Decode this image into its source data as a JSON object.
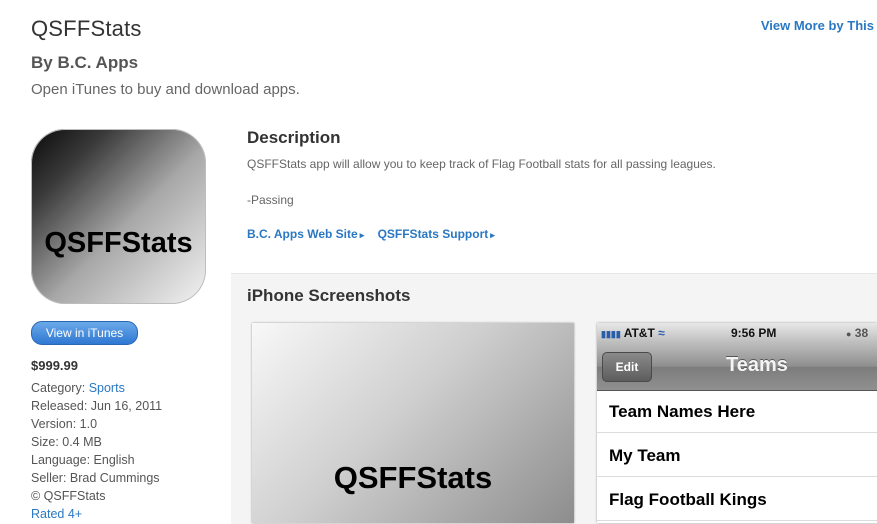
{
  "header": {
    "title": "QSFFStats",
    "developer": "By B.C. Apps",
    "open_itunes": "Open iTunes to buy and download apps.",
    "view_more": "View More by This D"
  },
  "icon": {
    "text": "QSFFStats"
  },
  "sidebar": {
    "view_button": "View in iTunes",
    "price": "$999.99",
    "category_label": "Category:",
    "category_value": "Sports",
    "released": "Released: Jun 16, 2011",
    "version": "Version: 1.0",
    "size": "Size: 0.4 MB",
    "language": "Language: English",
    "seller": "Seller: Brad Cummings",
    "copyright": "© QSFFStats",
    "rated": "Rated 4+"
  },
  "description": {
    "heading": "Description",
    "text": "QSFFStats app will allow you to keep track of Flag Football stats for all passing leagues.",
    "passing": "-Passing",
    "link_website": "B.C. Apps Web Site",
    "link_support": "QSFFStats Support"
  },
  "screenshots": {
    "heading": "iPhone Screenshots",
    "shot1_logo": "QSFFStats",
    "status": {
      "carrier": "AT&T",
      "time": "9:56 PM",
      "battery": "38"
    },
    "edit_label": "Edit",
    "nav_title": "Teams",
    "teams": [
      "Team Names Here",
      "My Team",
      "Flag Football Kings"
    ]
  },
  "colors": {
    "link": "#2a78c2",
    "button": "#2f78d2"
  }
}
